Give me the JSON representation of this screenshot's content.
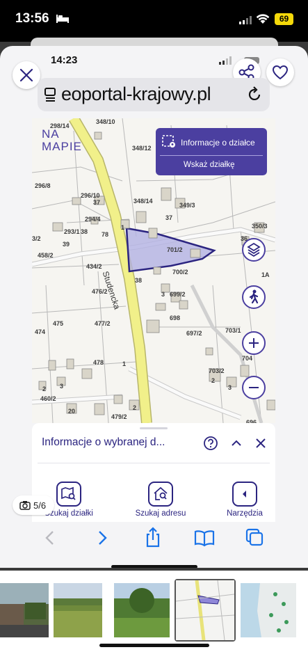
{
  "status_bar": {
    "time": "13:56",
    "battery": "69"
  },
  "inner_status_bar": {
    "time": "14:23"
  },
  "address_bar": {
    "url_visible": "eoportal-krajowy.pl"
  },
  "map": {
    "logo_top": "NA",
    "logo_bottom": "MAPIE",
    "info_box": {
      "title": "Informacje o działce",
      "subtitle": "Wskaż działkę"
    },
    "labels": [
      {
        "text": "298/14"
      },
      {
        "text": "348/10"
      },
      {
        "text": "348/12"
      },
      {
        "text": "296/8"
      },
      {
        "text": "296/10"
      },
      {
        "text": "37"
      },
      {
        "text": "348/14"
      },
      {
        "text": "349/3"
      },
      {
        "text": "294/4"
      },
      {
        "text": "37"
      },
      {
        "text": "293/1"
      },
      {
        "text": "38"
      },
      {
        "text": "1"
      },
      {
        "text": "78"
      },
      {
        "text": "350/3"
      },
      {
        "text": "3/2"
      },
      {
        "text": "39"
      },
      {
        "text": "36"
      },
      {
        "text": "458/2"
      },
      {
        "text": "701/2"
      },
      {
        "text": "434/2"
      },
      {
        "text": "700/2"
      },
      {
        "text": "1A"
      },
      {
        "text": "38"
      },
      {
        "text": "476/2"
      },
      {
        "text": "3"
      },
      {
        "text": "699/2"
      },
      {
        "text": "698"
      },
      {
        "text": "475"
      },
      {
        "text": "477/2"
      },
      {
        "text": "474"
      },
      {
        "text": "697/2"
      },
      {
        "text": "703/1"
      },
      {
        "text": "478"
      },
      {
        "text": "704"
      },
      {
        "text": "1"
      },
      {
        "text": "2"
      },
      {
        "text": "3"
      },
      {
        "text": "703/2"
      },
      {
        "text": "2"
      },
      {
        "text": "3"
      },
      {
        "text": "460/2"
      },
      {
        "text": "20"
      },
      {
        "text": "2"
      },
      {
        "text": "479/2"
      },
      {
        "text": "696"
      }
    ],
    "street_name": "Studencka"
  },
  "info_panel": {
    "title": "Informacje o wybranej d..."
  },
  "tools": [
    {
      "label": "Szukaj działki"
    },
    {
      "label": "Szukaj adresu"
    },
    {
      "label": "Narzędzia"
    }
  ],
  "photo_counter": "5/6",
  "colors": {
    "accent": "#4b3fa0",
    "dark_accent": "#2b2480",
    "road": "#f1f08a",
    "safari_blue": "#1a73e8"
  }
}
